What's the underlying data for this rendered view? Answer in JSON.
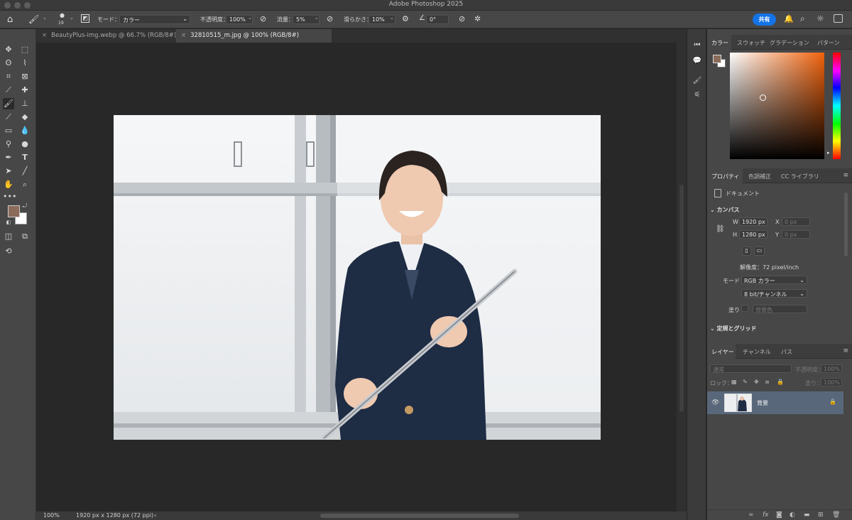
{
  "app": {
    "title": "Adobe Photoshop 2025"
  },
  "options_bar": {
    "brush_size": "19",
    "mode_label": "モード：",
    "mode_value": "カラー",
    "opacity_label": "不透明度：",
    "opacity_value": "100%",
    "flow_label": "流量：",
    "flow_value": "5%",
    "smoothing_label": "滑らかさ：",
    "smoothing_value": "10%",
    "angle_value": "0°",
    "share_label": "共有"
  },
  "tabs": [
    {
      "label": "BeautyPlus-img.webp @ 66.7% (RGB/8#)",
      "active": false
    },
    {
      "label": "32810515_m.jpg @ 100% (RGB/8#)",
      "active": true
    }
  ],
  "status_bar": {
    "zoom": "100%",
    "doc_info": "1920 px x 1280 px (72 ppi)"
  },
  "colors": {
    "foreground": "#8b6b5a",
    "background": "#ffffff",
    "accent": "#1473e6"
  },
  "color_panel": {
    "tabs": [
      "カラー",
      "スウォッチ",
      "グラデーション",
      "パターン"
    ],
    "active_tab": "カラー"
  },
  "properties_panel": {
    "tabs": [
      "プロパティ",
      "色調補正",
      "CC ライブラリ"
    ],
    "doc_label": "ドキュメント",
    "canvas_section": "カンバス",
    "w_label": "W",
    "w_value": "1920 px",
    "h_label": "H",
    "h_value": "1280 px",
    "x_label": "X",
    "x_value": "0 px",
    "y_label": "Y",
    "y_value": "0 px",
    "resolution": "解像度：72 pixel/inch",
    "mode_label": "モード",
    "mode_value": "RGB カラー",
    "bit_value": "8 bit/チャンネル",
    "fill_label": "塗り",
    "fill_value": "背景色",
    "rulers_section": "定規とグリッド"
  },
  "layers_panel": {
    "tabs": [
      "レイヤー",
      "チャンネル",
      "パス"
    ],
    "blend_mode": "通常",
    "opacity_label": "不透明度：",
    "opacity_value": "100%",
    "lock_label": "ロック：",
    "fill_label": "塗り：",
    "fill_value": "100%",
    "layer_name": "背景"
  }
}
